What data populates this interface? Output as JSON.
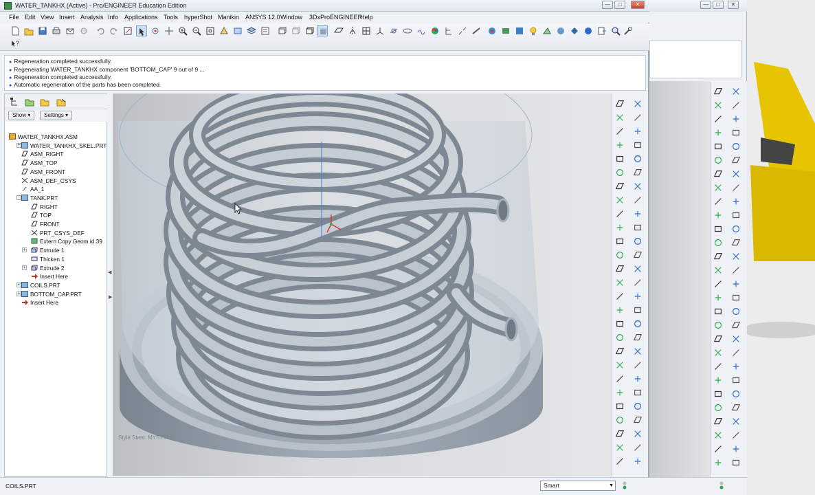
{
  "window": {
    "title": "WATER_TANKHX (Active) - Pro/ENGINEER Education Edition"
  },
  "menu": [
    "File",
    "Edit",
    "View",
    "Insert",
    "Analysis",
    "Info",
    "Applications",
    "Tools",
    "hyperShot",
    "Manikin",
    "ANSYS 12.0",
    "Window",
    "3DxProENGINEER",
    "Help"
  ],
  "messages": [
    "Regeneration completed successfully.",
    "Regenerating WATER_TANKHX component 'BOTTOM_CAP' 9 out of 9 ...",
    "Regeneration completed successfully.",
    "Automatic regeneration of the parts has been completed."
  ],
  "navigator": {
    "show_label": "Show",
    "settings_label": "Settings",
    "tree": [
      {
        "label": "WATER_TANKHX.ASM",
        "icon": "assembly-icon",
        "level": 0,
        "expander": ""
      },
      {
        "label": "WATER_TANKHX_SKEL.PRT",
        "icon": "part-icon",
        "level": 1,
        "expander": "+"
      },
      {
        "label": "ASM_RIGHT",
        "icon": "datum-plane-icon",
        "level": 1,
        "expander": ""
      },
      {
        "label": "ASM_TOP",
        "icon": "datum-plane-icon",
        "level": 1,
        "expander": ""
      },
      {
        "label": "ASM_FRONT",
        "icon": "datum-plane-icon",
        "level": 1,
        "expander": ""
      },
      {
        "label": "ASM_DEF_CSYS",
        "icon": "csys-icon",
        "level": 1,
        "expander": ""
      },
      {
        "label": "AA_1",
        "icon": "axis-icon",
        "level": 1,
        "expander": ""
      },
      {
        "label": "TANK.PRT",
        "icon": "part-icon",
        "level": 1,
        "expander": "-"
      },
      {
        "label": "RIGHT",
        "icon": "datum-plane-icon",
        "level": 2,
        "expander": ""
      },
      {
        "label": "TOP",
        "icon": "datum-plane-icon",
        "level": 2,
        "expander": ""
      },
      {
        "label": "FRONT",
        "icon": "datum-plane-icon",
        "level": 2,
        "expander": ""
      },
      {
        "label": "PRT_CSYS_DEF",
        "icon": "csys-icon",
        "level": 2,
        "expander": ""
      },
      {
        "label": "Extern Copy Geom id 39",
        "icon": "copy-geom-icon",
        "level": 2,
        "expander": ""
      },
      {
        "label": "Extrude 1",
        "icon": "extrude-icon",
        "level": 2,
        "expander": "+"
      },
      {
        "label": "Thicken 1",
        "icon": "thicken-icon",
        "level": 2,
        "expander": ""
      },
      {
        "label": "Extrude 2",
        "icon": "extrude-icon",
        "level": 2,
        "expander": "+"
      },
      {
        "label": "Insert Here",
        "icon": "insert-here-icon",
        "level": 2,
        "expander": ""
      },
      {
        "label": "COILS.PRT",
        "icon": "part-icon",
        "level": 1,
        "expander": "+"
      },
      {
        "label": "BOTTOM_CAP.PRT",
        "icon": "part-icon",
        "level": 1,
        "expander": "+"
      },
      {
        "label": "Insert Here",
        "icon": "insert-here-icon",
        "level": 1,
        "expander": ""
      }
    ]
  },
  "graphics": {
    "style_state": "Style State: MYSTYLE"
  },
  "statusbar": {
    "text": "COILS.PRT",
    "filter": "Smart"
  },
  "colors": {
    "accent": "#1a52b8",
    "model": "#a7b2bd",
    "background": "#d7d9dc"
  }
}
